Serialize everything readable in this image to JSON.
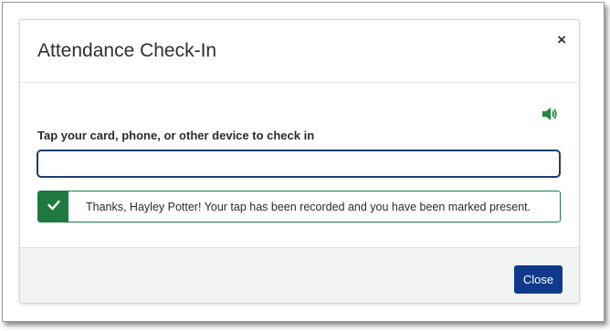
{
  "dialog": {
    "title": "Attendance Check-In",
    "close_icon_glyph": "×",
    "speaker_icon": "volume-icon",
    "field_label": "Tap your card, phone, or other device to check in",
    "input_value": "",
    "input_placeholder": "",
    "alert": {
      "icon": "checkmark-icon",
      "message": "Thanks, Hayley Potter! Your tap has been recorded and you have been marked present."
    },
    "close_button_label": "Close"
  },
  "colors": {
    "success_green": "#1f7a3f",
    "speaker_green": "#1f8a3e",
    "primary_button": "#0f3a8c",
    "input_border": "#1d3c70",
    "footer_bg": "#f1f2f2"
  }
}
